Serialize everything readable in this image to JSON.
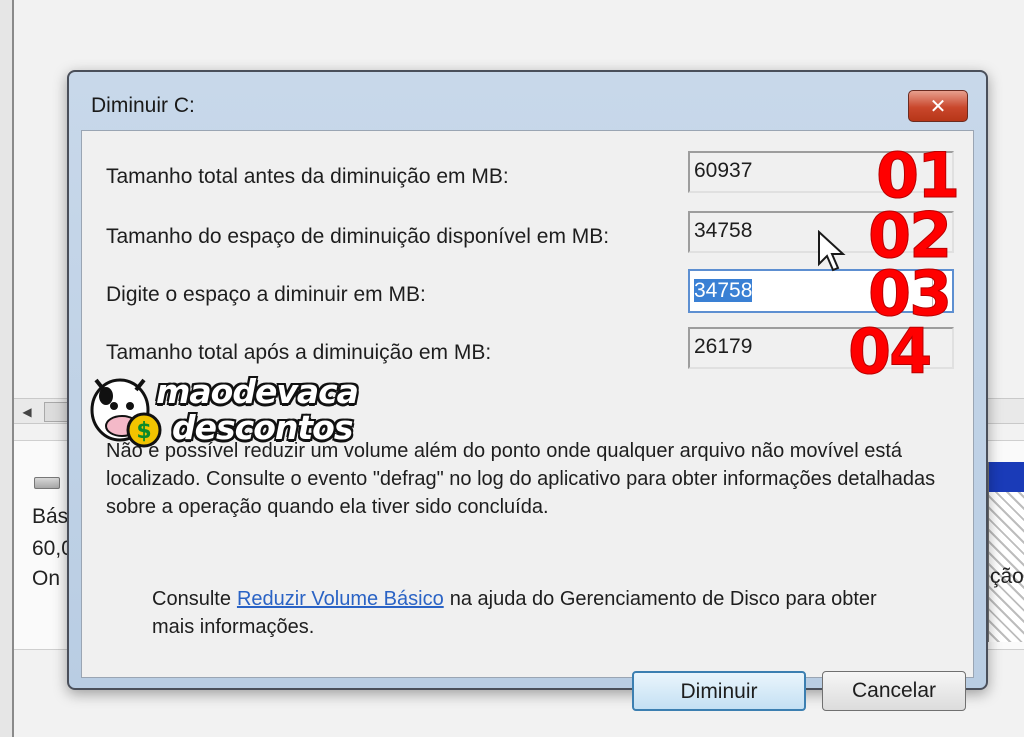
{
  "background": {
    "disk_text": [
      "Bás",
      "60,0",
      "On"
    ],
    "right_text": "ção"
  },
  "dialog": {
    "title": "Diminuir C:",
    "close_label": "✕",
    "rows": [
      {
        "label": "Tamanho total antes da diminuição em MB:",
        "value": "60937",
        "marker": "01"
      },
      {
        "label": "Tamanho do espaço de diminuição disponível em MB:",
        "value": "34758",
        "marker": "02"
      },
      {
        "label": "Digite o espaço a diminuir em MB:",
        "value": "34758",
        "marker": "03"
      },
      {
        "label": "Tamanho total após a diminuição em MB:",
        "value": "26179",
        "marker": "04"
      }
    ],
    "info": "Não é possível reduzir um volume além do ponto onde qualquer arquivo não movível está localizado. Consulte o evento \"defrag\" no log do aplicativo para obter informações detalhadas sobre a operação quando ela tiver sido concluída.",
    "help_prefix": "Consulte",
    "help_link": "Reduzir Volume Básico",
    "help_suffix": "na ajuda do Gerenciamento de Disco para obter mais informações.",
    "buttons": {
      "ok": "Diminuir",
      "cancel": "Cancelar"
    }
  },
  "watermark": {
    "line1": "maodevaca",
    "line2": "descontos"
  },
  "colors": {
    "marker": "#ff0000",
    "link": "#2a63c5",
    "selection": "#3a80d4"
  }
}
